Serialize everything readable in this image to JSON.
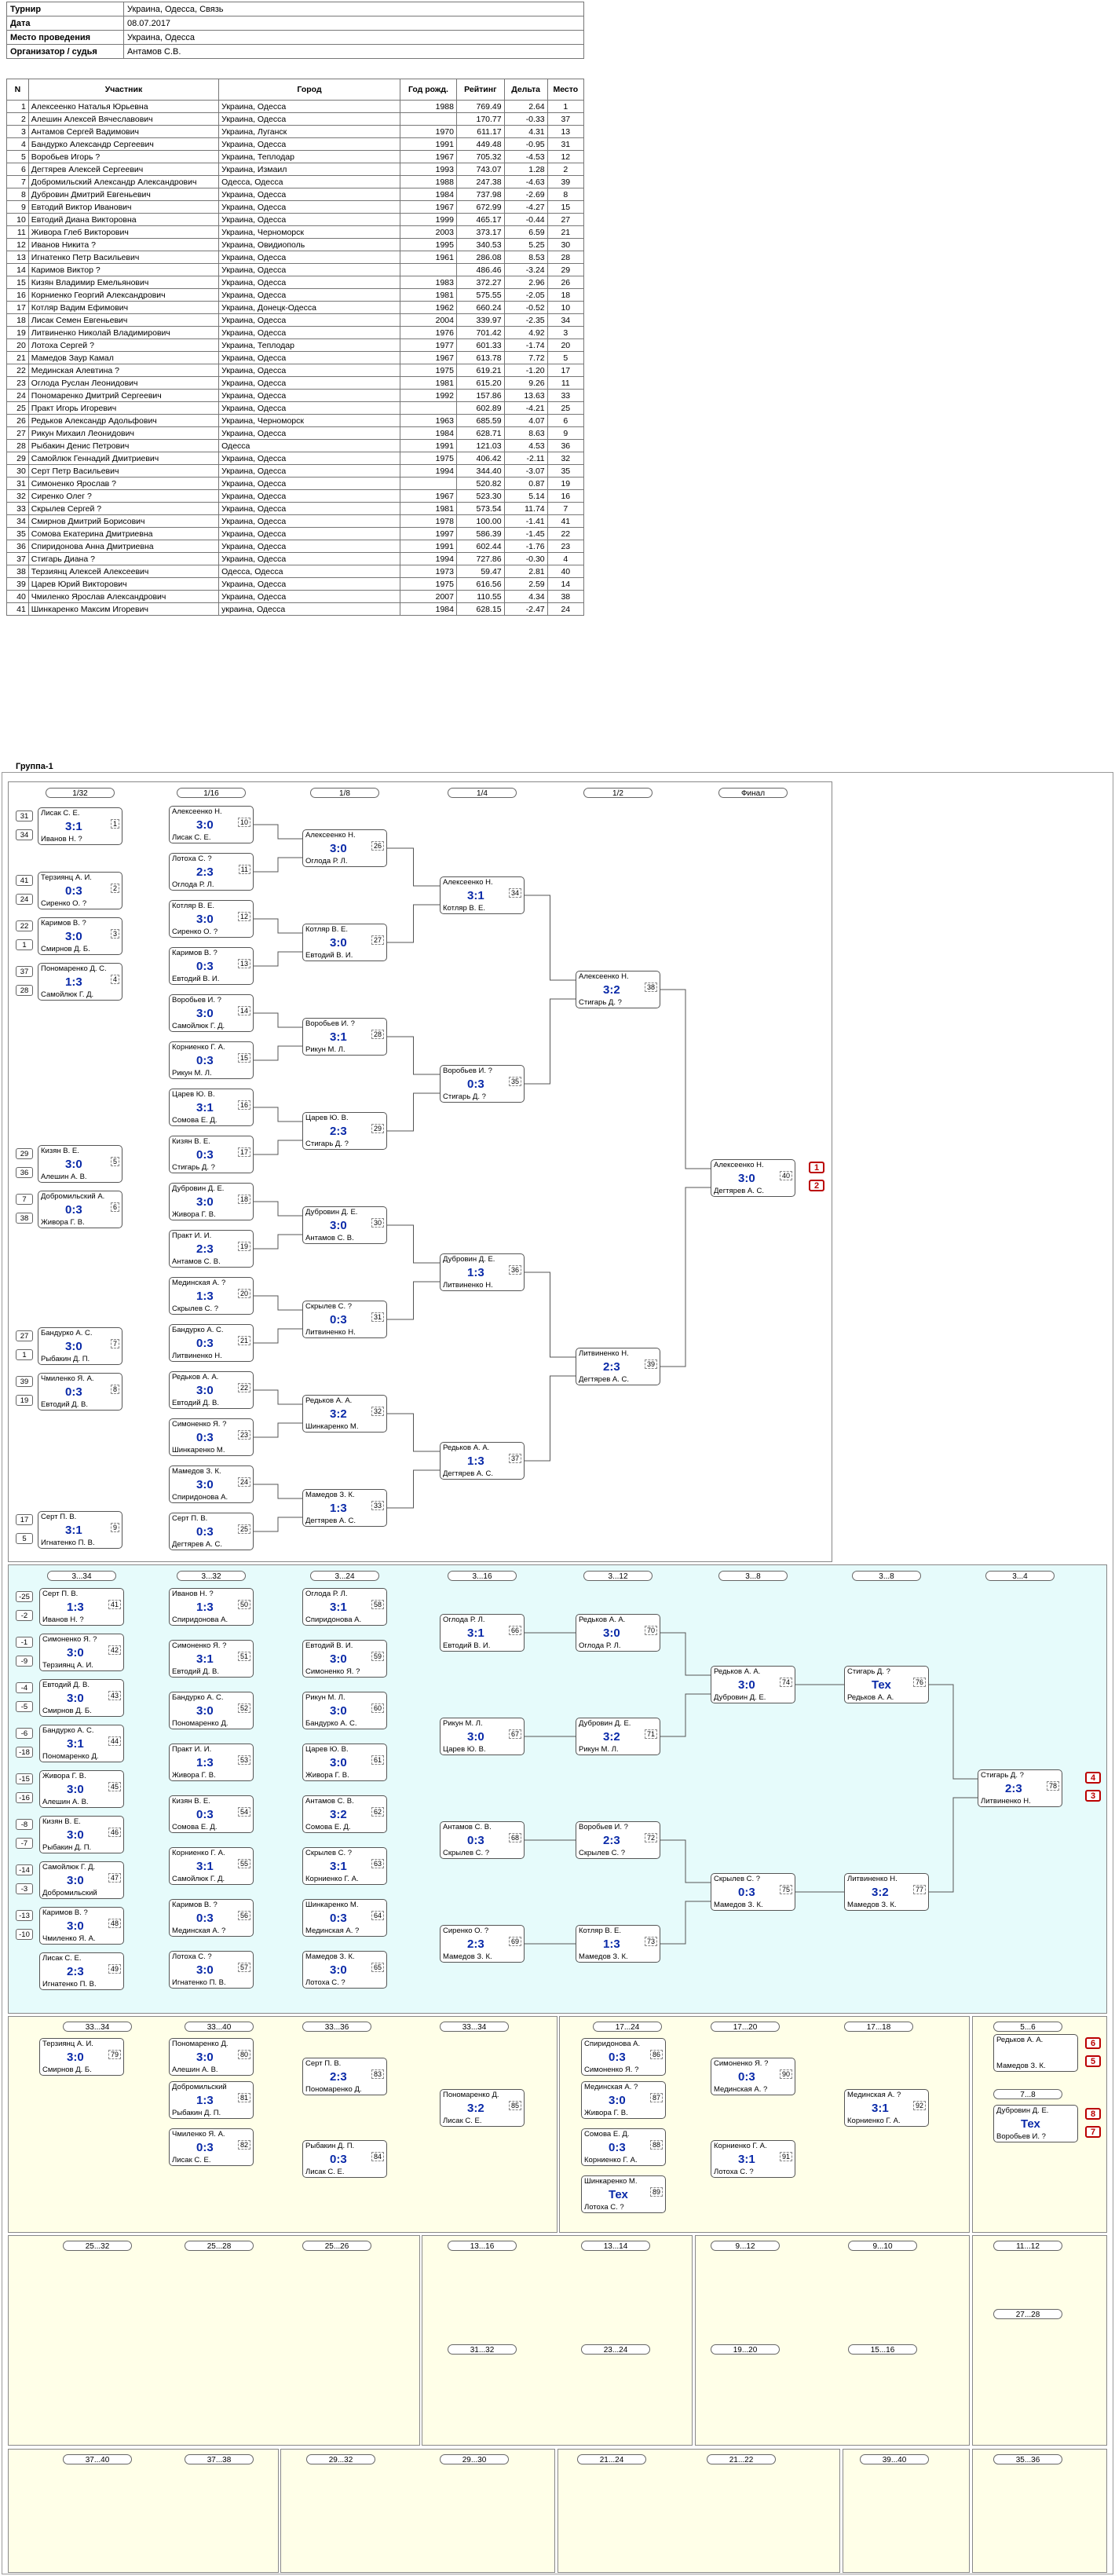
{
  "info": [
    {
      "k": "Турнир",
      "v": "Украина, Одесса, Связь"
    },
    {
      "k": "Дата",
      "v": "08.07.2017"
    },
    {
      "k": "Место проведения",
      "v": "Украина, Одесса"
    },
    {
      "k": "Организатор / судья",
      "v": "Антамов С.В."
    }
  ],
  "players_header": [
    "N",
    "Участник",
    "Город",
    "Год рожд.",
    "Рейтинг",
    "Дельта",
    "Место"
  ],
  "players": [
    [
      "1",
      "Алексеенко Наталья Юрьевна",
      "Украина, Одесса",
      "1988",
      "769.49",
      "2.64",
      "1"
    ],
    [
      "2",
      "Алешин Алексей Вячеславович",
      "Украина, Одесса",
      "",
      "170.77",
      "-0.33",
      "37"
    ],
    [
      "3",
      "Антамов Сергей Вадимович",
      "Украина, Луганск",
      "1970",
      "611.17",
      "4.31",
      "13"
    ],
    [
      "4",
      "Бандурко Александр Сергеевич",
      "Украина, Одесса",
      "1991",
      "449.48",
      "-0.95",
      "31"
    ],
    [
      "5",
      "Воробьев Игорь ?",
      "Украина, Теплодар",
      "1967",
      "705.32",
      "-4.53",
      "12"
    ],
    [
      "6",
      "Дегтярев Алексей Сергеевич",
      "Украина, Измаил",
      "1993",
      "743.07",
      "1.28",
      "2"
    ],
    [
      "7",
      "Добромильский Александр Александрович",
      "Одесса, Одесса",
      "1988",
      "247.38",
      "-4.63",
      "39"
    ],
    [
      "8",
      "Дубровин Дмитрий Евгеньевич",
      "Украина, Одесса",
      "1984",
      "737.98",
      "-2.69",
      "8"
    ],
    [
      "9",
      "Евтодий Виктор Иванович",
      "Украина, Одесса",
      "1967",
      "672.99",
      "-4.27",
      "15"
    ],
    [
      "10",
      "Евтодий Диана Викторовна",
      "Украина, Одесса",
      "1999",
      "465.17",
      "-0.44",
      "27"
    ],
    [
      "11",
      "Живора Глеб Викторович",
      "Украина, Черноморск",
      "2003",
      "373.17",
      "6.59",
      "21"
    ],
    [
      "12",
      "Иванов Никита ?",
      "Украина, Овидиополь",
      "1995",
      "340.53",
      "5.25",
      "30"
    ],
    [
      "13",
      "Игнатенко Петр Васильевич",
      "Украина, Одесса",
      "1961",
      "286.08",
      "8.53",
      "28"
    ],
    [
      "14",
      "Каримов Виктор ?",
      "Украина, Одесса",
      "",
      "486.46",
      "-3.24",
      "29"
    ],
    [
      "15",
      "Кизян Владимир Емельянович",
      "Украина, Одесса",
      "1983",
      "372.27",
      "2.96",
      "26"
    ],
    [
      "16",
      "Корниенко Георгий Александрович",
      "Украина, Одесса",
      "1981",
      "575.55",
      "-2.05",
      "18"
    ],
    [
      "17",
      "Котляр Вадим Ефимович",
      "Украина, Донецк-Одесса",
      "1962",
      "660.24",
      "-0.52",
      "10"
    ],
    [
      "18",
      "Лисак Семен Евгеньевич",
      "Украина, Одесса",
      "2004",
      "339.97",
      "-2.35",
      "34"
    ],
    [
      "19",
      "Литвиненко Николай Владимирович",
      "Украина, Одесса",
      "1976",
      "701.42",
      "4.92",
      "3"
    ],
    [
      "20",
      "Лотоха Сергей ?",
      "Украина, Теплодар",
      "1977",
      "601.33",
      "-1.74",
      "20"
    ],
    [
      "21",
      "Мамедов Заур Камал",
      "Украина, Одесса",
      "1967",
      "613.78",
      "7.72",
      "5"
    ],
    [
      "22",
      "Мединская Алевтина ?",
      "Украина, Одесса",
      "1975",
      "619.21",
      "-1.20",
      "17"
    ],
    [
      "23",
      "Оглода Руслан Леонидович",
      "Украина, Одесса",
      "1981",
      "615.20",
      "9.26",
      "11"
    ],
    [
      "24",
      "Пономаренко Дмитрий Сергеевич",
      "Украина, Одесса",
      "1992",
      "157.86",
      "13.63",
      "33"
    ],
    [
      "25",
      "Практ Игорь Игоревич",
      "Украина, Одесса",
      "",
      "602.89",
      "-4.21",
      "25"
    ],
    [
      "26",
      "Редьков Александр Адольфович",
      "Украина, Черноморск",
      "1963",
      "685.59",
      "4.07",
      "6"
    ],
    [
      "27",
      "Рикун Михаил Леонидович",
      "Украина, Одесса",
      "1984",
      "628.71",
      "8.63",
      "9"
    ],
    [
      "28",
      "Рыбакин Денис Петрович",
      "Одесса",
      "1991",
      "121.03",
      "4.53",
      "36"
    ],
    [
      "29",
      "Самойлюк Геннадий Дмитриевич",
      "Украина, Одесса",
      "1975",
      "406.42",
      "-2.11",
      "32"
    ],
    [
      "30",
      "Серт Петр Васильевич",
      "Украина, Одесса",
      "1994",
      "344.40",
      "-3.07",
      "35"
    ],
    [
      "31",
      "Симоненко Ярослав ?",
      "Украина, Одесса",
      "",
      "520.82",
      "0.87",
      "19"
    ],
    [
      "32",
      "Сиренко Олег ?",
      "Украина, Одесса",
      "1967",
      "523.30",
      "5.14",
      "16"
    ],
    [
      "33",
      "Скрылев Сергей ?",
      "Украина, Одесса",
      "1981",
      "573.54",
      "11.74",
      "7"
    ],
    [
      "34",
      "Смирнов Дмитрий Борисович",
      "Украина, Одесса",
      "1978",
      "100.00",
      "-1.41",
      "41"
    ],
    [
      "35",
      "Сомова Екатерина Дмитриевна",
      "Украина, Одесса",
      "1997",
      "586.39",
      "-1.45",
      "22"
    ],
    [
      "36",
      "Спиридонова Анна Дмитриевна",
      "Украина, Одесса",
      "1991",
      "602.44",
      "-1.76",
      "23"
    ],
    [
      "37",
      "Стигарь Диана ?",
      "Украина, Одесса",
      "1994",
      "727.86",
      "-0.30",
      "4"
    ],
    [
      "38",
      "Терзиянц Алексей Алексеевич",
      "Одесса, Одесса",
      "1973",
      "59.47",
      "2.81",
      "40"
    ],
    [
      "39",
      "Царев Юрий Викторович",
      "Украина, Одесса",
      "1975",
      "616.56",
      "2.59",
      "14"
    ],
    [
      "40",
      "Чмиленко Ярослав Александрович",
      "Украина, Одесса",
      "2007",
      "110.55",
      "4.34",
      "38"
    ],
    [
      "41",
      "Шинкаренко Максим Игоревич",
      "украина, Одесса",
      "1984",
      "628.15",
      "-2.47",
      "24"
    ]
  ],
  "group_title": "Группа-1",
  "main_rounds": [
    "1/32",
    "1/16",
    "1/8",
    "1/4",
    "1/2",
    "Финал"
  ],
  "main_seeds": [
    [
      "33",
      "32"
    ],
    [
      "41",
      "24"
    ],
    [
      "22",
      "1"
    ],
    [
      "37",
      "28"
    ],
    [
      "29",
      "36"
    ],
    [
      "7",
      "38"
    ],
    [
      "27",
      "1"
    ],
    [
      "39",
      "19"
    ],
    [
      "17",
      "5"
    ],
    [
      "31",
      "34"
    ]
  ],
  "main_r32": [
    {
      "p1": "Лисак С. Е.",
      "p2": "Иванов Н. ?",
      "sc": "3:1",
      "t": "1"
    },
    {
      "p1": "Терзиянц А. И.",
      "p2": "Сиренко О. ?",
      "sc": "0:3",
      "t": "2"
    },
    {
      "p1": "Каримов В. ?",
      "p2": "Смирнов Д. Б.",
      "sc": "3:0",
      "t": "3"
    },
    {
      "p1": "Пономаренко Д. С.",
      "p2": "Самойлюк Г. Д.",
      "sc": "1:3",
      "t": "4"
    },
    {
      "p1": "Кизян В. Е.",
      "p2": "Алешин А. В.",
      "sc": "3:0",
      "t": "5"
    },
    {
      "p1": "Добромильский А.",
      "p2": "Живора Г. В.",
      "sc": "0:3",
      "t": "6"
    },
    {
      "p1": "Бандурко А. С.",
      "p2": "Рыбакин Д. П.",
      "sc": "3:0",
      "t": "7"
    },
    {
      "p1": "Чмиленко Я. А.",
      "p2": "Евтодий Д. В.",
      "sc": "0:3",
      "t": "8"
    },
    {
      "p1": "Серт П. В.",
      "p2": "Игнатенко П. В.",
      "sc": "3:1",
      "t": "9"
    }
  ],
  "main_r16": [
    {
      "p1": "Алексеенко Н.",
      "p2": "Лисак С. Е.",
      "sc": "3:0",
      "t": "10"
    },
    {
      "p1": "Лотоха С. ?",
      "p2": "Оглода Р. Л.",
      "sc": "2:3",
      "t": "11"
    },
    {
      "p1": "Котляр В. Е.",
      "p2": "Сиренко О. ?",
      "sc": "3:0",
      "t": "12"
    },
    {
      "p1": "Каримов В. ?",
      "p2": "Евтодий В. И.",
      "sc": "0:3",
      "t": "13"
    },
    {
      "p1": "Воробьев И. ?",
      "p2": "Самойлюк Г. Д.",
      "sc": "3:0",
      "t": "14"
    },
    {
      "p1": "Корниенко Г. А.",
      "p2": "Рикун М. Л.",
      "sc": "0:3",
      "t": "15"
    },
    {
      "p1": "Царев Ю. В.",
      "p2": "Сомова Е. Д.",
      "sc": "3:1",
      "t": "16"
    },
    {
      "p1": "Кизян В. Е.",
      "p2": "Стигарь Д. ?",
      "sc": "0:3",
      "t": "17"
    },
    {
      "p1": "Дубровин Д. Е.",
      "p2": "Живора Г. В.",
      "sc": "3:0",
      "t": "18"
    },
    {
      "p1": "Практ И. И.",
      "p2": "Антамов С. В.",
      "sc": "2:3",
      "t": "19"
    },
    {
      "p1": "Мединская А. ?",
      "p2": "Скрылев С. ?",
      "sc": "1:3",
      "t": "20"
    },
    {
      "p1": "Бандурко А. С.",
      "p2": "Литвиненко Н.",
      "sc": "0:3",
      "t": "21"
    },
    {
      "p1": "Редьков А. А.",
      "p2": "Евтодий Д. В.",
      "sc": "3:0",
      "t": "22"
    },
    {
      "p1": "Симоненко Я. ?",
      "p2": "Шинкаренко М.",
      "sc": "0:3",
      "t": "23"
    },
    {
      "p1": "Мамедов З. К.",
      "p2": "Спиридонова А.",
      "sc": "3:0",
      "t": "24"
    },
    {
      "p1": "Серт П. В.",
      "p2": "Дегтярев А. С.",
      "sc": "0:3",
      "t": "25"
    }
  ],
  "main_r8": [
    {
      "p1": "Алексеенко Н.",
      "p2": "Оглода Р. Л.",
      "sc": "3:0",
      "t": "26"
    },
    {
      "p1": "Котляр В. Е.",
      "p2": "Евтодий В. И.",
      "sc": "3:0",
      "t": "27"
    },
    {
      "p1": "Воробьев И. ?",
      "p2": "Рикун М. Л.",
      "sc": "3:1",
      "t": "28"
    },
    {
      "p1": "Царев Ю. В.",
      "p2": "Стигарь Д. ?",
      "sc": "2:3",
      "t": "29"
    },
    {
      "p1": "Дубровин Д. Е.",
      "p2": "Антамов С. В.",
      "sc": "3:0",
      "t": "30"
    },
    {
      "p1": "Скрылев С. ?",
      "p2": "Литвиненко Н.",
      "sc": "0:3",
      "t": "31"
    },
    {
      "p1": "Редьков А. А.",
      "p2": "Шинкаренко М.",
      "sc": "3:2",
      "t": "32"
    },
    {
      "p1": "Мамедов З. К.",
      "p2": "Дегтярев А. С.",
      "sc": "1:3",
      "t": "33"
    }
  ],
  "main_r4": [
    {
      "p1": "Алексеенко Н.",
      "p2": "Котляр В. Е.",
      "sc": "3:1",
      "t": "34"
    },
    {
      "p1": "Воробьев И. ?",
      "p2": "Стигарь Д. ?",
      "sc": "0:3",
      "t": "35"
    },
    {
      "p1": "Дубровин Д. Е.",
      "p2": "Литвиненко Н.",
      "sc": "1:3",
      "t": "36"
    },
    {
      "p1": "Редьков А. А.",
      "p2": "Дегтярев А. С.",
      "sc": "1:3",
      "t": "37"
    }
  ],
  "main_r2": [
    {
      "p1": "Алексеенко Н.",
      "p2": "Стигарь Д. ?",
      "sc": "3:2",
      "t": "38"
    },
    {
      "p1": "Литвиненко Н.",
      "p2": "Дегтярев А. С.",
      "sc": "2:3",
      "t": "39"
    }
  ],
  "main_final": {
    "p1": "Алексеенко Н.",
    "p2": "Дегтярев А. С.",
    "sc": "3:0",
    "t": "40",
    "m1": "1",
    "m2": "2"
  },
  "cyan_rounds": [
    "3...34",
    "3...32",
    "3...24",
    "3...16",
    "3...12",
    "3...8",
    "3...8",
    "3...4"
  ],
  "cyan_seeds": [
    [
      "-25",
      "-2"
    ],
    [
      "-1",
      "-9"
    ],
    [
      "-4",
      "-5"
    ],
    [
      "-6",
      "-18"
    ],
    [
      "-15",
      "-16"
    ],
    [
      "-8",
      "-7"
    ],
    [
      "-14",
      "-3"
    ],
    [
      "-13",
      "-10"
    ]
  ],
  "cyan_col1": [
    {
      "p1": "Серт П. В.",
      "p2": "Иванов Н. ?",
      "sc": "1:3",
      "t": "41"
    },
    {
      "p1": "Симоненко Я. ?",
      "p2": "Терзиянц А. И.",
      "sc": "3:0",
      "t": "42"
    },
    {
      "p1": "Евтодий Д. В.",
      "p2": "Смирнов Д. Б.",
      "sc": "3:0",
      "t": "43"
    },
    {
      "p1": "Бандурко А. С.",
      "p2": "Пономаренко Д.",
      "sc": "3:1",
      "t": "44"
    },
    {
      "p1": "Живора Г. В.",
      "p2": "Алешин А. В.",
      "sc": "3:0",
      "t": "45"
    },
    {
      "p1": "Кизян В. Е.",
      "p2": "Рыбакин Д. П.",
      "sc": "3:0",
      "t": "46"
    },
    {
      "p1": "Самойлюк Г. Д.",
      "p2": "Добромильский",
      "sc": "3:0",
      "t": "47"
    },
    {
      "p1": "Каримов В. ?",
      "p2": "Чмиленко Я. А.",
      "sc": "3:0",
      "t": "48"
    },
    {
      "p1": "Лисак С. Е.",
      "p2": "Игнатенко П. В.",
      "sc": "2:3",
      "t": "49"
    }
  ],
  "cyan_col2": [
    {
      "p1": "Иванов Н. ?",
      "p2": "Спиридонова А.",
      "sc": "1:3",
      "t": "50"
    },
    {
      "p1": "Симоненко Я. ?",
      "p2": "Евтодий Д. В.",
      "sc": "3:1",
      "t": "51"
    },
    {
      "p1": "Бандурко А. С.",
      "p2": "Пономаренко Д.",
      "sc": "3:0",
      "t": "52"
    },
    {
      "p1": "Практ И. И.",
      "p2": "Живора Г. В.",
      "sc": "1:3",
      "t": "53"
    },
    {
      "p1": "Кизян В. Е.",
      "p2": "Сомова Е. Д.",
      "sc": "0:3",
      "t": "54"
    },
    {
      "p1": "Корниенко Г. А.",
      "p2": "Самойлюк Г. Д.",
      "sc": "3:1",
      "t": "55"
    },
    {
      "p1": "Каримов В. ?",
      "p2": "Мединская А. ?",
      "sc": "0:3",
      "t": "56"
    },
    {
      "p1": "Лотоха С. ?",
      "p2": "Игнатенко П. В.",
      "sc": "3:0",
      "t": "57"
    }
  ],
  "cyan_col3": [
    {
      "p1": "Оглода Р. Л.",
      "p2": "Спиридонова А.",
      "sc": "3:1",
      "t": "58"
    },
    {
      "p1": "Евтодий В. И.",
      "p2": "Симоненко Я. ?",
      "sc": "3:0",
      "t": "59"
    },
    {
      "p1": "Рикун М. Л.",
      "p2": "Бандурко А. С.",
      "sc": "3:0",
      "t": "60"
    },
    {
      "p1": "Царев Ю. В.",
      "p2": "Живора Г. В.",
      "sc": "3:0",
      "t": "61"
    },
    {
      "p1": "Антамов С. В.",
      "p2": "Сомова Е. Д.",
      "sc": "3:2",
      "t": "62"
    },
    {
      "p1": "Скрылев С. ?",
      "p2": "Корниенко Г. А.",
      "sc": "3:1",
      "t": "63"
    },
    {
      "p1": "Шинкаренко М.",
      "p2": "Мединская А. ?",
      "sc": "0:3",
      "t": "64"
    },
    {
      "p1": "Мамедов З. К.",
      "p2": "Лотоха С. ?",
      "sc": "3:0",
      "t": "65"
    }
  ],
  "cyan_col4": [
    {
      "p1": "Оглода Р. Л.",
      "p2": "Евтодий В. И.",
      "sc": "3:1",
      "t": "66"
    },
    {
      "p1": "Рикун М. Л.",
      "p2": "Царев Ю. В.",
      "sc": "3:0",
      "t": "67"
    },
    {
      "p1": "Антамов С. В.",
      "p2": "Скрылев С. ?",
      "sc": "0:3",
      "t": "68"
    },
    {
      "p1": "Сиренко О. ?",
      "p2": "Мамедов З. К.",
      "sc": "2:3",
      "t": "69"
    }
  ],
  "cyan_col5": [
    {
      "p1": "Редьков А. А.",
      "p2": "Оглода Р. Л.",
      "sc": "3:0",
      "t": "70"
    },
    {
      "p1": "Дубровин Д. Е.",
      "p2": "Рикун М. Л.",
      "sc": "3:2",
      "t": "71"
    },
    {
      "p1": "Воробьев И. ?",
      "p2": "Скрылев С. ?",
      "sc": "2:3",
      "t": "72"
    },
    {
      "p1": "Котляр В. Е.",
      "p2": "Мамедов З. К.",
      "sc": "1:3",
      "t": "73"
    }
  ],
  "cyan_col6": [
    {
      "p1": "Редьков А. А.",
      "p2": "Дубровин Д. Е.",
      "sc": "3:0",
      "t": "74"
    },
    {
      "p1": "Скрылев С. ?",
      "p2": "Мамедов З. К.",
      "sc": "0:3",
      "t": "75"
    }
  ],
  "cyan_col7": [
    {
      "p1": "Стигарь Д. ?",
      "p2": "Редьков А. А.",
      "sc": "Тех",
      "t": "76"
    },
    {
      "p1": "Литвиненко Н.",
      "p2": "Мамедов З. К.",
      "sc": "3:2",
      "t": "77"
    }
  ],
  "cyan_col8": {
    "p1": "Стигарь Д. ?",
    "p2": "Литвиненко Н.",
    "sc": "2:3",
    "t": "78",
    "m1": "4",
    "m2": "3"
  },
  "small_titles": [
    "33...34",
    "33...40",
    "33...36",
    "33...34",
    "17...24",
    "17...20",
    "17...18",
    "5...6",
    "7...8",
    "25...32",
    "25...28",
    "25...26",
    "13...16",
    "13...14",
    "9...12",
    "9...10",
    "11...12",
    "27...28",
    "31...32",
    "23...24",
    "19...20",
    "15...16",
    "37...40",
    "37...38",
    "29...32",
    "29...30",
    "21...24",
    "21...22",
    "39...40",
    "35...36"
  ],
  "small_matches": [
    {
      "p1": "Терзиянц А. И.",
      "p2": "Смирнов Д. Б.",
      "sc": "3:0",
      "t": "79"
    },
    {
      "p1": "Пономаренко Д.",
      "p2": "Алешин А. В.",
      "sc": "3:0",
      "t": "80"
    },
    {
      "p1": "Добромильский",
      "p2": "Рыбакин Д. П.",
      "sc": "1:3",
      "t": "81"
    },
    {
      "p1": "Чмиленко Я. А.",
      "p2": "Лисак С. Е.",
      "sc": "0:3",
      "t": "82"
    },
    {
      "p1": "Серт П. В.",
      "p2": "Пономаренко Д.",
      "sc": "2:3",
      "t": "83"
    },
    {
      "p1": "Рыбакин Д. П.",
      "p2": "Лисак С. Е.",
      "sc": "0:3",
      "t": "84"
    },
    {
      "p1": "Пономаренко Д.",
      "p2": "Лисак С. Е.",
      "sc": "3:2",
      "t": "85"
    },
    {
      "p1": "Спиридонова А.",
      "p2": "Симоненко Я. ?",
      "sc": "0:3",
      "t": "86"
    },
    {
      "p1": "Мединская А. ?",
      "p2": "Живора Г. В.",
      "sc": "3:0",
      "t": "87"
    },
    {
      "p1": "Сомова Е. Д.",
      "p2": "Корниенко Г. А.",
      "sc": "0:3",
      "t": "88"
    },
    {
      "p1": "Шинкаренко М.",
      "p2": "Лотоха С. ?",
      "sc": "Тех",
      "t": "89"
    },
    {
      "p1": "Симоненко Я. ?",
      "p2": "Мединская А. ?",
      "sc": "0:3",
      "t": "90"
    },
    {
      "p1": "Корниенко Г. А.",
      "p2": "Лотоха С. ?",
      "sc": "3:1",
      "t": "91"
    },
    {
      "p1": "Мединская А. ?",
      "p2": "Корниенко Г. А.",
      "sc": "3:1",
      "t": "92"
    },
    {
      "p1": "Редьков А. А.",
      "p2": "Мамедов З. К.",
      "sc": "",
      "t": ""
    },
    {
      "p1": "Дубровин Д. Е.",
      "p2": "Воробьев И. ?",
      "sc": "Тех",
      "t": ""
    }
  ],
  "final_places": {
    "a": "6",
    "b": "5",
    "c": "8",
    "d": "7"
  }
}
